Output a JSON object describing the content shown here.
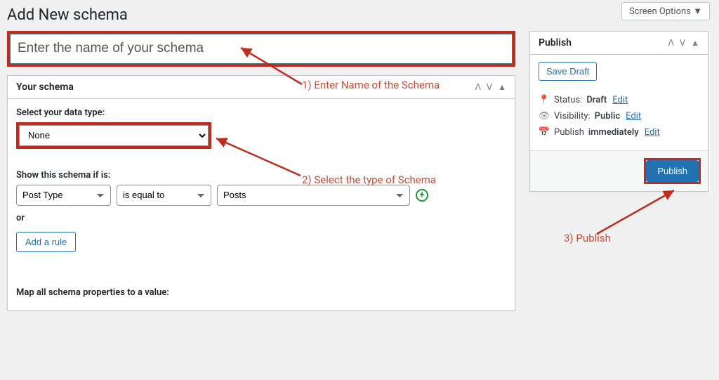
{
  "screen_options": "Screen Options ▼",
  "page_title": "Add New schema",
  "title_placeholder": "Enter the name of your schema",
  "schema_box": {
    "heading": "Your schema",
    "data_type_label": "Select your data type:",
    "data_type_value": "None",
    "show_if_label": "Show this schema if is:",
    "rule": {
      "field": "Post Type",
      "op": "is equal to",
      "value": "Posts"
    },
    "or": "or",
    "add_rule": "Add a rule",
    "map_label": "Map all schema properties to a value:"
  },
  "publish": {
    "heading": "Publish",
    "save_draft": "Save Draft",
    "status_label": "Status:",
    "status_value": "Draft",
    "visibility_label": "Visibility:",
    "visibility_value": "Public",
    "publish_time_label": "Publish",
    "publish_time_value": "immediately",
    "edit": "Edit",
    "submit": "Publish"
  },
  "annotations": {
    "a1": "1) Enter Name of the Schema",
    "a2": "2) Select the type of Schema",
    "a3": "3) Publish"
  }
}
